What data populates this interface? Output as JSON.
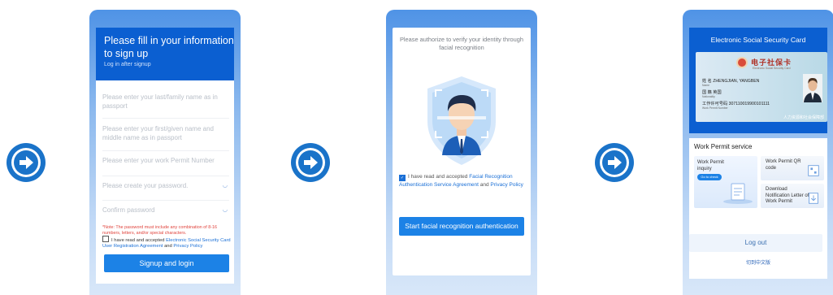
{
  "signup": {
    "title": "Please fill in your information to sign up",
    "subtitle": "Log in after signup",
    "fields": [
      {
        "placeholder": "Please enter your last/family name as in passport"
      },
      {
        "placeholder": "Please enter your first/given name and middle name as in passport"
      },
      {
        "placeholder": "Please enter your work Permit Number"
      },
      {
        "placeholder": "Please create your password."
      },
      {
        "placeholder": "Confirm password"
      }
    ],
    "note": "*Note: The password must include any combination of 8-16 numbers, letters, and/or special characters.",
    "agree_text": "I have read and accepted",
    "agree_link1": "Electronic Social Security Card User Registration Agreement",
    "agree_and": "and",
    "agree_link2": "Privacy Policy",
    "button": "Signup and login"
  },
  "face": {
    "prompt": "Please authorize to verify your identity through facial recognition",
    "agree_text": "I have read and accepted",
    "agree_link1": "Facial Recognition Authentication Service Agreement",
    "agree_and": "and",
    "agree_link2": "Privacy Policy",
    "button": "Start facial recognition authentication"
  },
  "card": {
    "title": "Electronic Social Security Card",
    "card_cn": "电子社保卡",
    "card_en": "Electronic Social Security Card",
    "name_line": "姓 名 ZHENGJIAN, YANGBEN",
    "name_label": "Name",
    "nat_line": "国 籍 英国",
    "nat_label": "Nationality",
    "permit_line": "工作许可号码 307110019900101111",
    "permit_label": "Work Permit Number",
    "issuer": "人力资源和社会保障部",
    "service_title": "Work Permit service",
    "svc_inquiry": "Work Permit inquiry",
    "svc_check": "Go to check",
    "svc_qr": "Work Permit QR code",
    "svc_download": "Download Notification Letter of Work Permit",
    "logout": "Log out",
    "lang": "切到中文版"
  },
  "colors": {
    "primary": "#0b5fd1",
    "button": "#1c82e6",
    "arrow": "#1a73c9",
    "warning": "#e0443d"
  }
}
